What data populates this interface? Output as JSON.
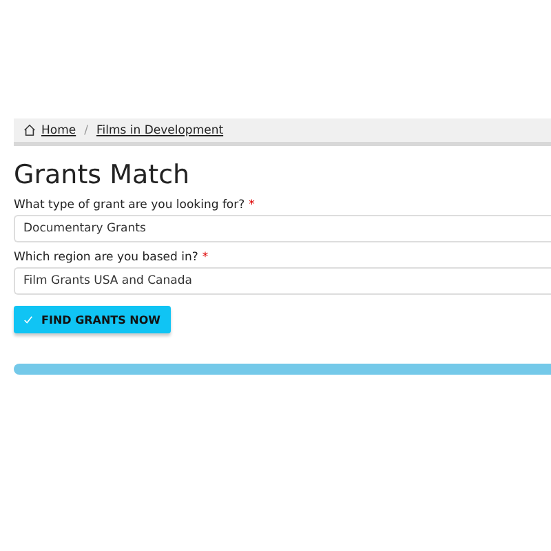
{
  "breadcrumb": [
    {
      "label": "Home",
      "kind": "home"
    },
    {
      "label": "Films in Development",
      "kind": "link"
    }
  ],
  "separator": "/",
  "title": "Grants Match",
  "fields": [
    {
      "label": "What type of grant are you looking for?",
      "required_mark": "*",
      "value": "Documentary Grants"
    },
    {
      "label": "Which region are you based in?",
      "required_mark": "*",
      "value": "Film Grants USA and Canada"
    }
  ],
  "button": {
    "label": "FIND GRANTS NOW"
  },
  "progress": {
    "level": 1
  }
}
